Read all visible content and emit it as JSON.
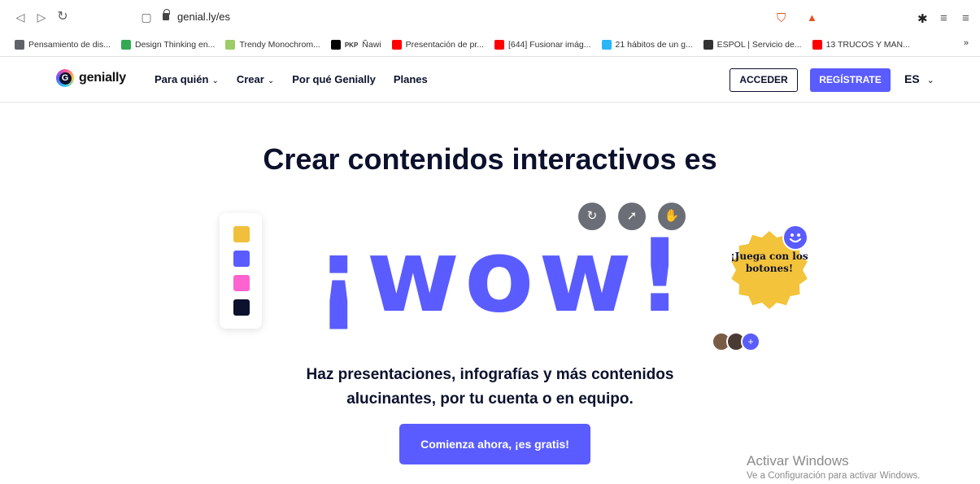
{
  "browser": {
    "url": "genial.ly/es",
    "bookmarks": [
      {
        "label": "Pensamiento de dis...",
        "color": "#5f6368"
      },
      {
        "label": "Design Thinking en...",
        "color": "#34a853"
      },
      {
        "label": "Trendy Monochrom...",
        "color": "#9ccc65"
      },
      {
        "label": "Ñawi",
        "color": "#000000",
        "prefix": "PKP"
      },
      {
        "label": "Presentación de pr...",
        "color": "#ff0000"
      },
      {
        "label": "[644] Fusionar imág...",
        "color": "#ff0000"
      },
      {
        "label": "21 hábitos de un g...",
        "color": "#29b6f6"
      },
      {
        "label": "ESPOL | Servicio de...",
        "color": "#333333"
      },
      {
        "label": "13 TRUCOS Y MAN...",
        "color": "#ff0000"
      }
    ],
    "more": "»"
  },
  "header": {
    "logo_text": "genially",
    "nav": [
      {
        "label": "Para quién",
        "chevron": "⌄"
      },
      {
        "label": "Crear",
        "chevron": "⌄"
      },
      {
        "label": "Por qué Genially",
        "chevron": ""
      },
      {
        "label": "Planes",
        "chevron": ""
      }
    ],
    "login": "ACCEDER",
    "signup": "REGÍSTRATE",
    "lang": "ES",
    "lang_chevron": "⌄"
  },
  "hero": {
    "title": "Crear contenidos interactivos es",
    "wow": "¡wow!",
    "badge": "¡Juega con los botones!",
    "subtitle": "Haz presentaciones, infografías y más contenidos alucinantes, por tu cuenta o en equipo.",
    "cta": "Comienza ahora, ¡es gratis!",
    "palette_colors": [
      "#f0bf3c",
      "#5a5cff",
      "#ff63d0",
      "#0c112d"
    ],
    "accent": "#5a5cff",
    "badge_color": "#f3c33b"
  },
  "watermark": {
    "line1": "Activar Windows",
    "line2": "Ve a Configuración para activar Windows."
  }
}
